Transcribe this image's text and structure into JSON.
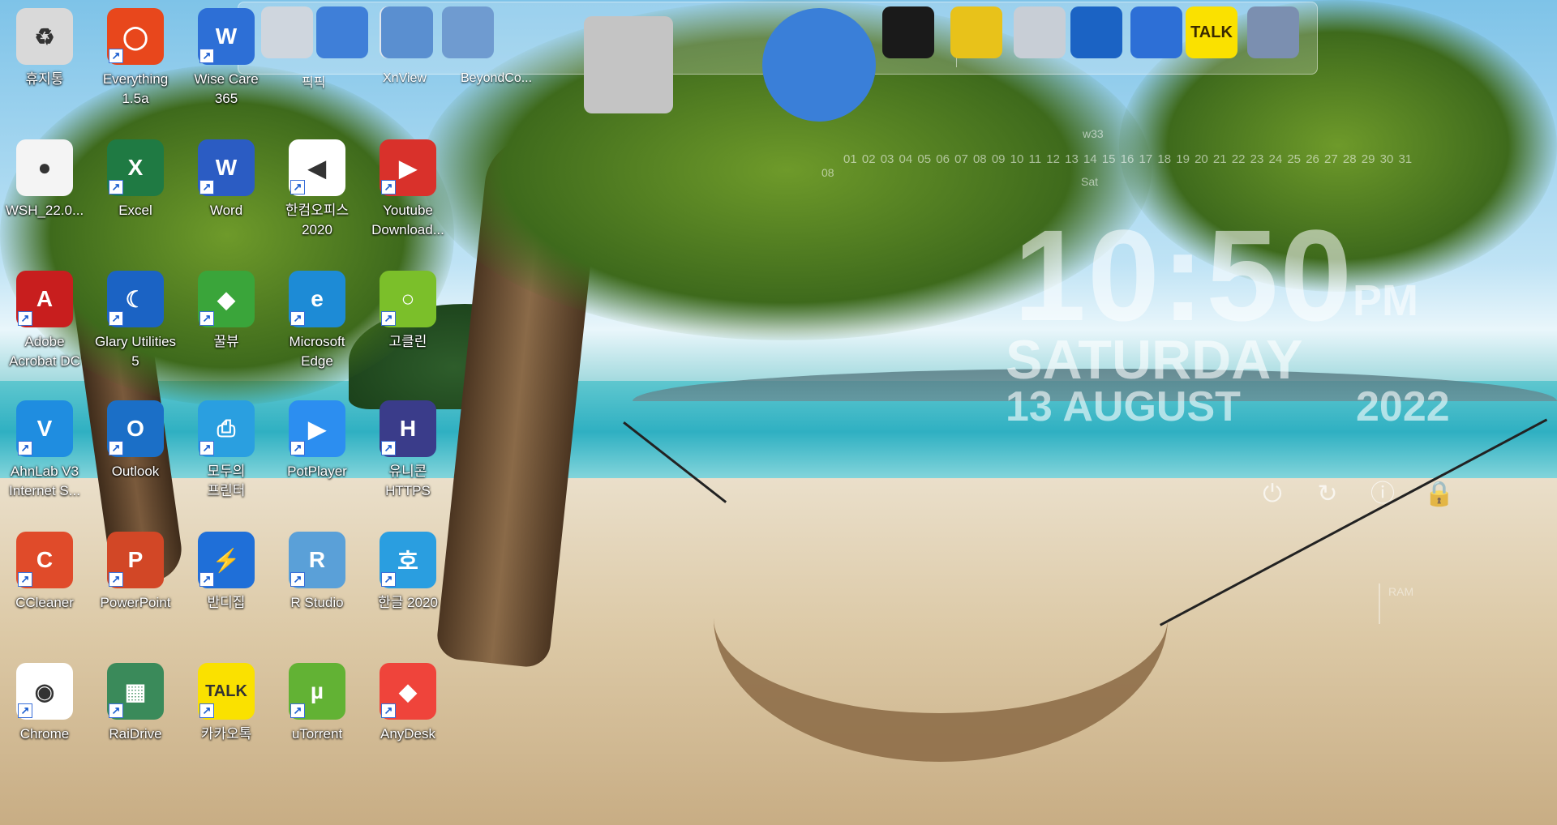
{
  "dock": {
    "items": [
      {
        "name": "file-manager",
        "label": ""
      },
      {
        "name": "internet-explorer",
        "label": ""
      },
      {
        "name": "picpick",
        "label": "픽픽"
      },
      {
        "name": "xnview",
        "label": "XnView"
      },
      {
        "name": "beyond-compare",
        "label": "BeyondCo..."
      },
      {
        "name": "settings-tools",
        "label": ""
      },
      {
        "name": "globe-plane",
        "label": ""
      },
      {
        "name": "tshirt",
        "label": ""
      },
      {
        "name": "wrench-tool",
        "label": ""
      },
      {
        "name": "recycle-bin",
        "label": ""
      },
      {
        "name": "glary",
        "label": ""
      },
      {
        "name": "wise-care",
        "label": ""
      },
      {
        "name": "kakaotalk",
        "label": "TALK"
      },
      {
        "name": "r-recorder",
        "label": ""
      }
    ]
  },
  "desktop_icons": [
    {
      "label": "휴지통",
      "color": "#d9d9d9",
      "glyph": "♻",
      "shortcut": false
    },
    {
      "label": "Everything\n1.5a",
      "color": "#e8471c",
      "glyph": "◯",
      "shortcut": true
    },
    {
      "label": "Wise Care\n365",
      "color": "#2d6fd6",
      "glyph": "W",
      "shortcut": true
    },
    {
      "label": "WSH_22.0...",
      "color": "#f4f4f4",
      "glyph": "●",
      "shortcut": false
    },
    {
      "label": "Excel",
      "color": "#1f7a43",
      "glyph": "X",
      "shortcut": true
    },
    {
      "label": "Word",
      "color": "#2b5cc3",
      "glyph": "W",
      "shortcut": true
    },
    {
      "label": "한컴오피스\n2020",
      "color": "#ffffff",
      "glyph": "◀",
      "shortcut": true
    },
    {
      "label": "Youtube\nDownload...",
      "color": "#d9312b",
      "glyph": "▶",
      "shortcut": true
    },
    {
      "label": "Adobe\nAcrobat DC",
      "color": "#c81e1e",
      "glyph": "A",
      "shortcut": true
    },
    {
      "label": "Glary Utilities\n5",
      "color": "#1b63c4",
      "glyph": "☾",
      "shortcut": true
    },
    {
      "label": "꿀뷰",
      "color": "#3aa53a",
      "glyph": "◆",
      "shortcut": true
    },
    {
      "label": "Microsoft\nEdge",
      "color": "#1d8bd6",
      "glyph": "e",
      "shortcut": true
    },
    {
      "label": "고클린",
      "color": "#7bbf2a",
      "glyph": "○",
      "shortcut": true
    },
    {
      "label": "AhnLab V3\nInternet S...",
      "color": "#1f8de0",
      "glyph": "V",
      "shortcut": true
    },
    {
      "label": "Outlook",
      "color": "#1b6fc7",
      "glyph": "O",
      "shortcut": true
    },
    {
      "label": "모두의\n프린터",
      "color": "#2a9fe0",
      "glyph": "⎙",
      "shortcut": true
    },
    {
      "label": "PotPlayer",
      "color": "#2c8ef0",
      "glyph": "▶",
      "shortcut": true
    },
    {
      "label": "유니콘\nHTTPS",
      "color": "#3a3c8a",
      "glyph": "H",
      "shortcut": true
    },
    {
      "label": "CCleaner",
      "color": "#e04b2a",
      "glyph": "C",
      "shortcut": true
    },
    {
      "label": "PowerPoint",
      "color": "#d24726",
      "glyph": "P",
      "shortcut": true
    },
    {
      "label": "반디집",
      "color": "#1f6fd8",
      "glyph": "⚡",
      "shortcut": true
    },
    {
      "label": "R Studio",
      "color": "#5aa0d8",
      "glyph": "R",
      "shortcut": true
    },
    {
      "label": "한글 2020",
      "color": "#2a9ee0",
      "glyph": "호",
      "shortcut": true
    },
    {
      "label": "Chrome",
      "color": "#ffffff",
      "glyph": "◉",
      "shortcut": true
    },
    {
      "label": "RaiDrive",
      "color": "#3a8a5a",
      "glyph": "▦",
      "shortcut": true
    },
    {
      "label": "카카오톡",
      "color": "#fae100",
      "glyph": "TALK",
      "shortcut": true
    },
    {
      "label": "uTorrent",
      "color": "#62b234",
      "glyph": "µ",
      "shortcut": true
    },
    {
      "label": "AnyDesk",
      "color": "#ef443b",
      "glyph": "◆",
      "shortcut": true
    }
  ],
  "clock": {
    "time": "10:50",
    "ampm": "PM",
    "day": "SATURDAY",
    "date": "13 AUGUST",
    "year": "2022",
    "week": "w33",
    "month": "08",
    "dow": "Sat",
    "days": "01 02 03 04 05 06 07 08 09 10 11 12 13 14 15 16 17 18 19 20 21 22 23 24 25 26 27 28 29 30 31"
  },
  "power_buttons": [
    {
      "name": "power-icon",
      "glyph": "⏻"
    },
    {
      "name": "restart-icon",
      "glyph": "↻"
    },
    {
      "name": "hibernate-icon",
      "glyph": "ⓘ"
    },
    {
      "name": "lock-icon",
      "glyph": "🔒"
    }
  ],
  "system": {
    "ram_label": "RAM"
  }
}
